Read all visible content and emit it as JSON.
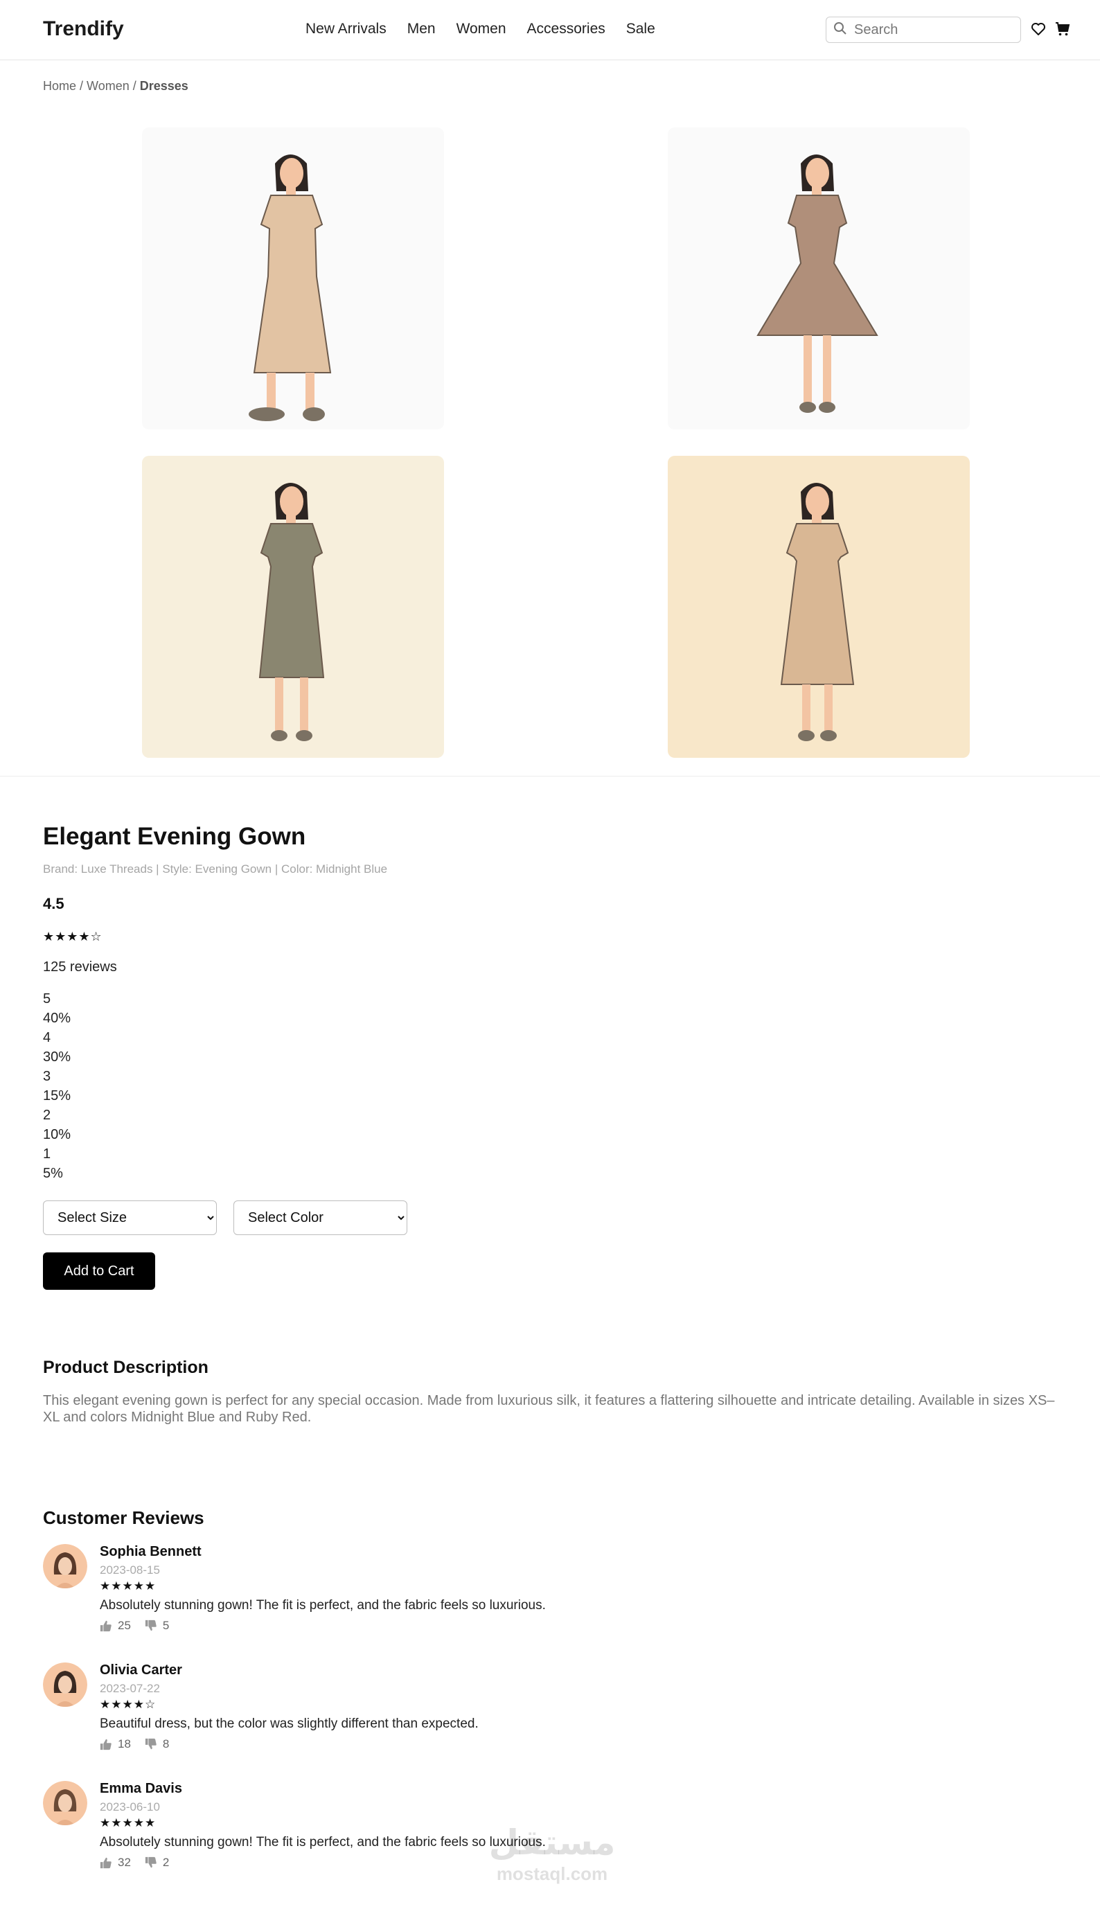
{
  "header": {
    "logo": "Trendify",
    "nav": [
      "New Arrivals",
      "Men",
      "Women",
      "Accessories",
      "Sale"
    ],
    "search_placeholder": "Search",
    "icons": [
      "search-icon",
      "heart-icon",
      "cart-icon"
    ]
  },
  "breadcrumb": {
    "home": "Home",
    "sep1": " / ",
    "women": "Women",
    "sep2": " / ",
    "current": "Dresses"
  },
  "gallery": {
    "images": [
      {
        "name": "dress-image-1",
        "bg": "#fafafa",
        "dress": "#e2c3a3"
      },
      {
        "name": "dress-image-2",
        "bg": "#fafafa",
        "dress": "#b08f7a"
      },
      {
        "name": "dress-image-3",
        "bg": "#f7efdc",
        "dress": "#8a8670"
      },
      {
        "name": "dress-image-4",
        "bg": "#f8e7c9",
        "dress": "#d9b794"
      }
    ]
  },
  "product": {
    "title": "Elegant Evening Gown",
    "meta": "Brand: Luxe Threads | Style: Evening Gown | Color: Midnight Blue",
    "rating": "4.5",
    "stars": "★★★★☆",
    "review_count": "125 reviews",
    "breakdown": [
      "5",
      "40%",
      "4",
      "30%",
      "3",
      "15%",
      "2",
      "10%",
      "1",
      "5%"
    ],
    "size_select": "Select Size",
    "color_select": "Select Color",
    "add_to_cart": "Add to Cart"
  },
  "description": {
    "heading": "Product Description",
    "text": "This elegant evening gown is perfect for any special occasion. Made from luxurious silk, it features a flattering silhouette and intricate detailing. Available in sizes XS–XL and colors Midnight Blue and Ruby Red."
  },
  "reviews": {
    "heading": "Customer Reviews",
    "items": [
      {
        "name": "Sophia Bennett",
        "date": "2023-08-15",
        "stars": "★★★★★",
        "text": "Absolutely stunning gown! The fit is perfect, and the fabric feels so luxurious.",
        "likes": "25",
        "dislikes": "5"
      },
      {
        "name": "Olivia Carter",
        "date": "2023-07-22",
        "stars": "★★★★☆",
        "text": "Beautiful dress, but the color was slightly different than expected.",
        "likes": "18",
        "dislikes": "8"
      },
      {
        "name": "Emma Davis",
        "date": "2023-06-10",
        "stars": "★★★★★",
        "text": "Absolutely stunning gown! The fit is perfect, and the fabric feels so luxurious.",
        "likes": "32",
        "dislikes": "2"
      }
    ]
  },
  "watermark": {
    "logo": "مستقل",
    "url": "mostaql.com"
  }
}
